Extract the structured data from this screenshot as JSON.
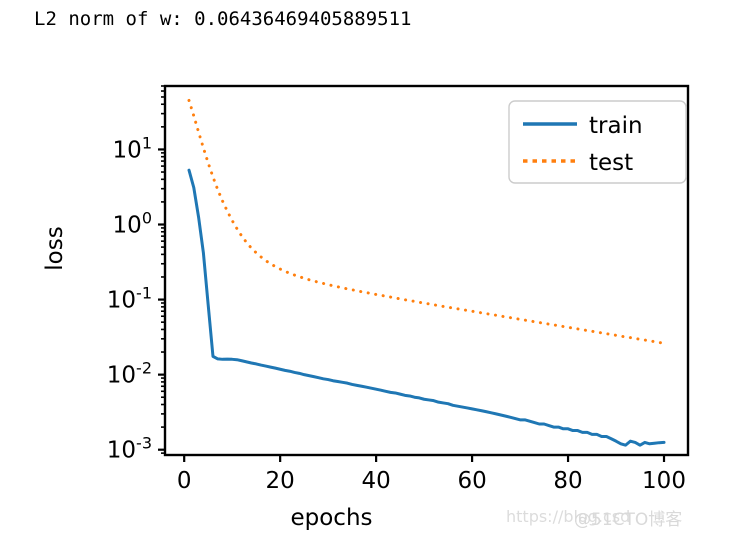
{
  "figure": {
    "title": "L2 norm of w: 0.06436469405889511",
    "background": "#ffffff",
    "axes_color": "#000000"
  },
  "watermark": {
    "url_text": "https://blog.csd",
    "brand_text": "@51CTO博客",
    "color": "#dcdcdc"
  },
  "legend": {
    "entries": [
      {
        "label": "train",
        "color": "#1f77b4",
        "style": "solid"
      },
      {
        "label": "test",
        "color": "#ff7f0e",
        "style": "dotted"
      }
    ],
    "frame_color": "#cccccc",
    "position": "upper right"
  },
  "chart_data": {
    "type": "line",
    "title": "L2 norm of w: 0.06436469405889511",
    "xlabel": "epochs",
    "ylabel": "loss",
    "xscale": "linear",
    "yscale": "log",
    "xlim": [
      -4,
      105
    ],
    "ylim": [
      0.00085,
      70
    ],
    "xticks": [
      0,
      20,
      40,
      60,
      80,
      100
    ],
    "xticklabels": [
      "0",
      "20",
      "40",
      "60",
      "80",
      "100"
    ],
    "yticks": [
      10,
      1,
      0.1,
      0.01,
      0.001
    ],
    "yticklabels": [
      "10^1",
      "10^0",
      "10^-1",
      "10^-2",
      "10^-3"
    ],
    "ytick_exponents": [
      "1",
      "0",
      "-1",
      "-2",
      "-3"
    ],
    "grid": false,
    "legend_position": "upper right",
    "x": [
      1,
      2,
      3,
      4,
      5,
      6,
      7,
      8,
      9,
      10,
      11,
      12,
      13,
      14,
      15,
      16,
      17,
      18,
      19,
      20,
      21,
      22,
      23,
      24,
      25,
      26,
      27,
      28,
      29,
      30,
      31,
      32,
      33,
      34,
      35,
      36,
      37,
      38,
      39,
      40,
      41,
      42,
      43,
      44,
      45,
      46,
      47,
      48,
      49,
      50,
      51,
      52,
      53,
      54,
      55,
      56,
      57,
      58,
      59,
      60,
      61,
      62,
      63,
      64,
      65,
      66,
      67,
      68,
      69,
      70,
      71,
      72,
      73,
      74,
      75,
      76,
      77,
      78,
      79,
      80,
      81,
      82,
      83,
      84,
      85,
      86,
      87,
      88,
      89,
      90,
      91,
      92,
      93,
      94,
      95,
      96,
      97,
      98,
      99,
      100
    ],
    "series": [
      {
        "name": "train",
        "color": "#1f77b4",
        "style": "solid",
        "linewidth": 3,
        "values": [
          5.3,
          3.1,
          1.25,
          0.42,
          0.085,
          0.0175,
          0.0162,
          0.016,
          0.0161,
          0.016,
          0.0158,
          0.0153,
          0.0148,
          0.0143,
          0.0139,
          0.0134,
          0.013,
          0.0126,
          0.0122,
          0.0118,
          0.0114,
          0.0111,
          0.0107,
          0.0104,
          0.01,
          0.0097,
          0.0094,
          0.0091,
          0.0088,
          0.0086,
          0.0083,
          0.0081,
          0.0079,
          0.0077,
          0.0074,
          0.0072,
          0.007,
          0.0068,
          0.0066,
          0.0064,
          0.0062,
          0.006,
          0.0058,
          0.0057,
          0.0055,
          0.0053,
          0.0052,
          0.005,
          0.0049,
          0.0047,
          0.0046,
          0.0045,
          0.0043,
          0.0042,
          0.0041,
          0.0039,
          0.0038,
          0.0037,
          0.0036,
          0.0035,
          0.0034,
          0.0033,
          0.0032,
          0.0031,
          0.003,
          0.0029,
          0.0028,
          0.0027,
          0.0026,
          0.0025,
          0.0025,
          0.0024,
          0.0023,
          0.0022,
          0.0022,
          0.0021,
          0.002,
          0.002,
          0.0019,
          0.0019,
          0.0018,
          0.0018,
          0.0017,
          0.0017,
          0.0016,
          0.0016,
          0.0015,
          0.0015,
          0.0014,
          0.0013,
          0.0012,
          0.00115,
          0.0013,
          0.00125,
          0.00115,
          0.00125,
          0.0012,
          0.00122,
          0.00124,
          0.00125
        ]
      },
      {
        "name": "test",
        "color": "#ff7f0e",
        "style": "dotted",
        "linewidth": 3,
        "values": [
          45.0,
          28.0,
          17.0,
          10.5,
          6.6,
          4.3,
          2.9,
          2.05,
          1.5,
          1.13,
          0.88,
          0.7,
          0.575,
          0.485,
          0.42,
          0.37,
          0.33,
          0.3,
          0.275,
          0.255,
          0.238,
          0.224,
          0.212,
          0.202,
          0.192,
          0.184,
          0.177,
          0.17,
          0.164,
          0.158,
          0.153,
          0.148,
          0.143,
          0.139,
          0.135,
          0.131,
          0.127,
          0.124,
          0.12,
          0.117,
          0.114,
          0.111,
          0.108,
          0.105,
          0.102,
          0.0995,
          0.097,
          0.0945,
          0.092,
          0.0897,
          0.0875,
          0.0853,
          0.0832,
          0.0811,
          0.0791,
          0.0772,
          0.0753,
          0.0734,
          0.0716,
          0.0699,
          0.0682,
          0.0665,
          0.0649,
          0.0633,
          0.0618,
          0.0603,
          0.0588,
          0.0574,
          0.056,
          0.0546,
          0.0533,
          0.052,
          0.0507,
          0.0495,
          0.0483,
          0.0471,
          0.046,
          0.0449,
          0.0438,
          0.0427,
          0.0417,
          0.0407,
          0.0397,
          0.0387,
          0.0378,
          0.0369,
          0.036,
          0.0351,
          0.0343,
          0.0334,
          0.0326,
          0.0318,
          0.0311,
          0.0303,
          0.0296,
          0.0289,
          0.0282,
          0.0275,
          0.0268,
          0.0262
        ]
      }
    ]
  }
}
